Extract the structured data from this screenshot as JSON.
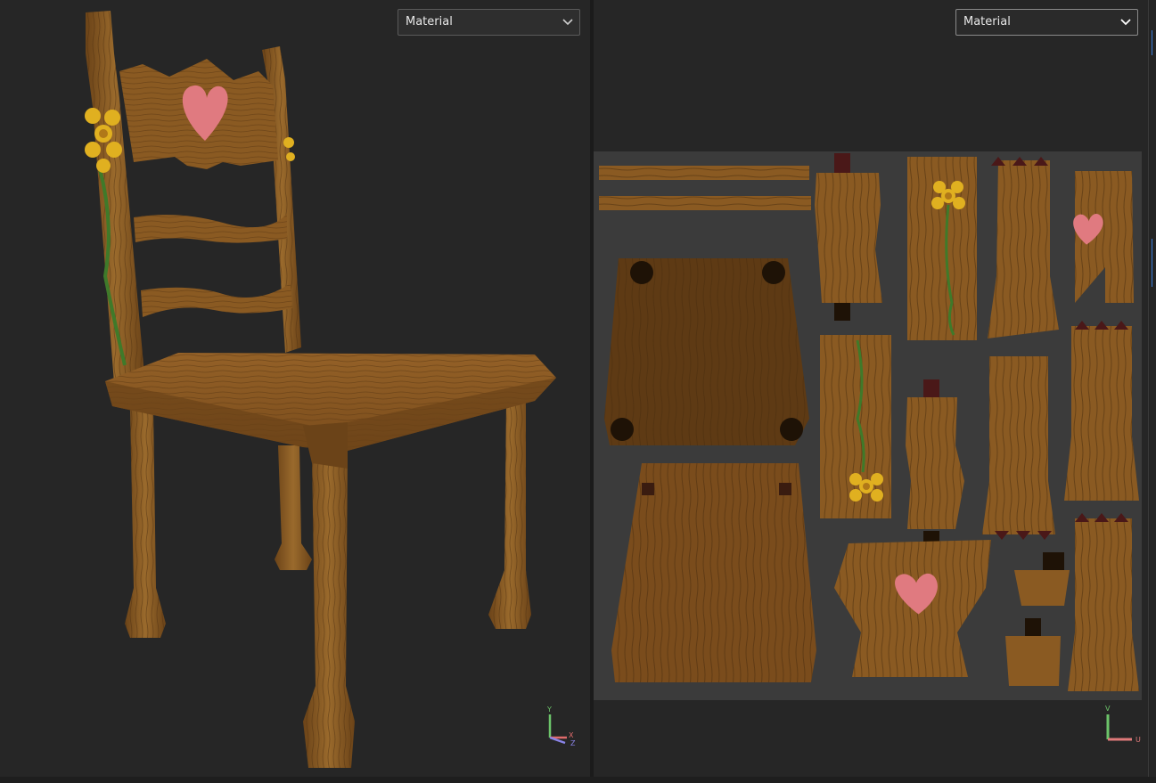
{
  "viewport_3d": {
    "dropdown": {
      "label": "Material",
      "icon": "chevron-down-icon"
    },
    "gizmo": {
      "axis_y": "Y",
      "axis_x": "X",
      "axis_z": "Z"
    },
    "colors": {
      "y": "#6cc46a",
      "x": "#e06b6b",
      "z": "#8a84e8"
    }
  },
  "viewport_uv": {
    "dropdown": {
      "label": "Material",
      "icon": "chevron-down-icon"
    },
    "gizmo": {
      "axis_v": "V",
      "axis_u": "U"
    },
    "colors": {
      "v": "#6cc46a",
      "u": "#e07a7a"
    }
  },
  "colors": {
    "wood": "#8a5a22",
    "wood_dark": "#5e3a14",
    "heart": "#e07a80",
    "flower": "#e0b020",
    "vine": "#3f7a2a",
    "viewport_bg": "#262626",
    "uv_bg": "#3b3b3b"
  }
}
